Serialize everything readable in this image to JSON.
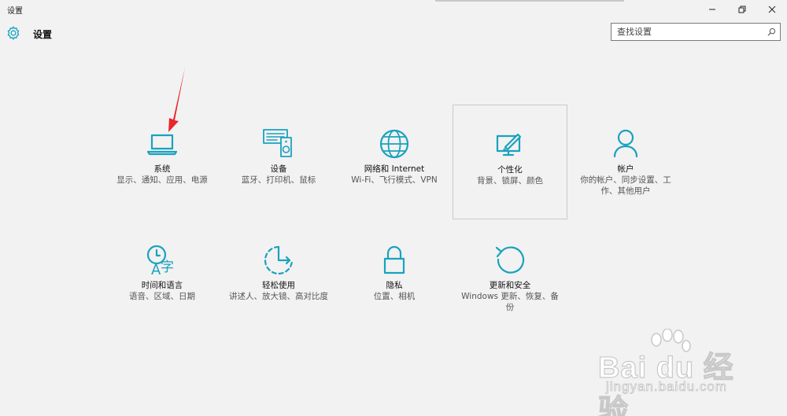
{
  "window": {
    "title": "设置",
    "controls": {
      "minimize": "—",
      "restore": "❐",
      "close": "✕"
    }
  },
  "header": {
    "title": "设置",
    "icon": "gear-icon"
  },
  "search": {
    "placeholder": "查找设置",
    "icon": "search-icon"
  },
  "colors": {
    "accent": "#1aa2be",
    "background": "#f2f2f2",
    "arrow": "#e8262c"
  },
  "tiles": [
    {
      "label": "系统",
      "desc": "显示、通知、应用、电源",
      "icon": "laptop-icon"
    },
    {
      "label": "设备",
      "desc": "蓝牙、打印机、鼠标",
      "icon": "devices-icon"
    },
    {
      "label": "网络和 Internet",
      "desc": "Wi-Fi、飞行模式、VPN",
      "icon": "globe-icon"
    },
    {
      "label": "个性化",
      "desc": "背景、锁屏、颜色",
      "icon": "personalization-icon",
      "selected": true
    },
    {
      "label": "帐户",
      "desc": "你的帐户、同步设置、工作、其他用户",
      "icon": "person-icon"
    },
    {
      "label": "时间和语言",
      "desc": "语音、区域、日期",
      "icon": "time-language-icon"
    },
    {
      "label": "轻松使用",
      "desc": "讲述人、放大镜、高对比度",
      "icon": "ease-of-access-icon"
    },
    {
      "label": "隐私",
      "desc": "位置、相机",
      "icon": "lock-icon"
    },
    {
      "label": "更新和安全",
      "desc": "Windows 更新、恢复、备份",
      "icon": "update-icon"
    }
  ],
  "watermark": {
    "brand": "Bai du 经验",
    "url": "jingyan.baidu.com"
  }
}
